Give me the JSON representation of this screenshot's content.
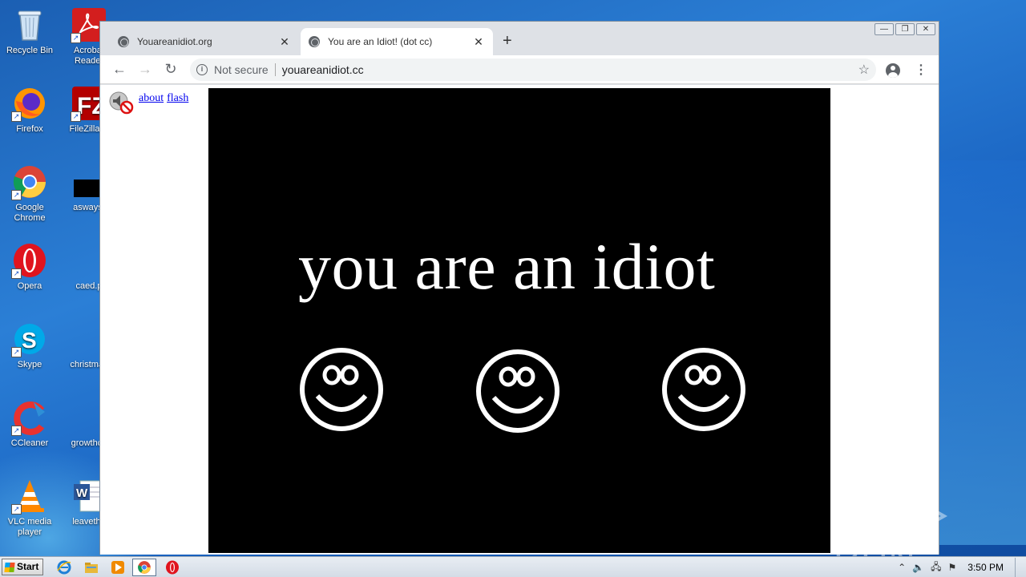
{
  "desktop": {
    "icons": [
      {
        "name": "recycle-bin",
        "label": "Recycle Bin"
      },
      {
        "name": "acrobat-reader",
        "label": "Acrobat Reader"
      },
      {
        "name": "firefox",
        "label": "Firefox"
      },
      {
        "name": "filezilla",
        "label": "FileZilla C"
      },
      {
        "name": "google-chrome",
        "label": "Google Chrome"
      },
      {
        "name": "asways-file",
        "label": "asways."
      },
      {
        "name": "opera",
        "label": "Opera"
      },
      {
        "name": "caed-file",
        "label": "caed.p"
      },
      {
        "name": "skype",
        "label": "Skype"
      },
      {
        "name": "christmas-file",
        "label": "christmas"
      },
      {
        "name": "ccleaner",
        "label": "CCleaner"
      },
      {
        "name": "growthch-file",
        "label": "growthch"
      },
      {
        "name": "vlc-media-player",
        "label": "VLC media player"
      },
      {
        "name": "leavethe-file",
        "label": "leavethe"
      }
    ]
  },
  "browser": {
    "tabs": [
      {
        "title": "Youareanidiot.org",
        "active": false
      },
      {
        "title": "You are an Idiot! (dot cc)",
        "active": true
      }
    ],
    "new_tab_symbol": "+",
    "omnibox": {
      "security_text": "Not secure",
      "url": "youareanidiot.cc"
    },
    "window_controls": [
      "minimize",
      "restore",
      "close"
    ]
  },
  "page": {
    "links": [
      "about",
      "flash"
    ],
    "main_text": "you are an idiot",
    "smiley_count": 3,
    "colors": {
      "background": "#000000",
      "foreground": "#ffffff",
      "link": "#0000ee"
    }
  },
  "watermark": {
    "left": "ANY",
    "right": "RUN"
  },
  "taskbar": {
    "start_label": "Start",
    "pinned": [
      "internet-explorer",
      "file-explorer",
      "media-player",
      "chrome",
      "opera"
    ],
    "clock": "3:50 PM"
  }
}
